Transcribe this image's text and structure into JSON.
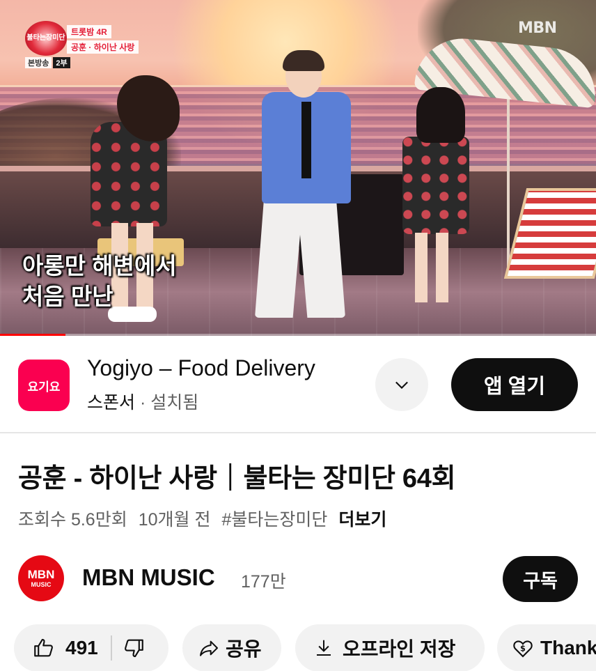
{
  "video": {
    "show_logo_text": "불타는장미단",
    "info_line1": "트롯밤 4R",
    "info_line2": "공훈 · 하이난 사랑",
    "broadcast_label": "본방송",
    "broadcast_part": "2부",
    "network_logo": "MBN",
    "subtitle_line1": "아롱만 해변에서",
    "subtitle_line2": "처음 만난",
    "progress_fraction": 0.11,
    "progress_color": "#ff0000"
  },
  "ad": {
    "icon_text": "요기요",
    "icon_color": "#fa0050",
    "title": "Yogiyo – Food Delivery",
    "sponsor_label": "스폰서",
    "dot": " · ",
    "install_label": "설치됨",
    "expand_icon": "chevron-down-icon",
    "open_button": "앱 열기"
  },
  "video_info": {
    "title": "공훈 - 하이난 사랑｜불타는 장미단 64회",
    "views": "조회수 5.6만회",
    "age": "10개월 전",
    "hashtag": "#불타는장미단",
    "more": "더보기"
  },
  "channel": {
    "avatar_line1": "MBN",
    "avatar_line2": "MUSIC",
    "avatar_color": "#e50914",
    "name": "MBN MUSIC",
    "subscribers": "177만",
    "subscribe_button": "구독"
  },
  "actions": {
    "like_count": "491",
    "share_label": "공유",
    "offline_label": "오프라인 저장",
    "thanks_label": "Thank"
  }
}
